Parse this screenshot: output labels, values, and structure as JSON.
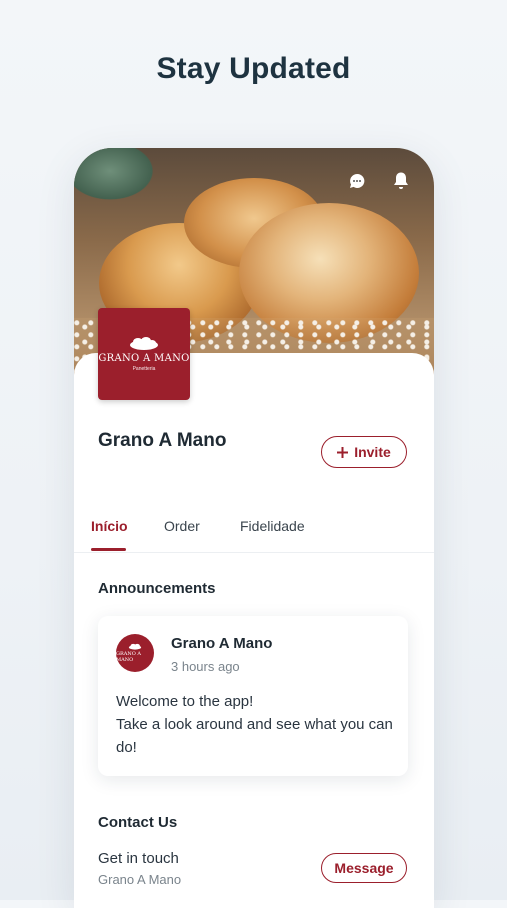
{
  "headline": "Stay Updated",
  "colors": {
    "brand": "#9b1f2c",
    "text": "#1f2a33",
    "muted": "#7a848c"
  },
  "header_icons": [
    "chat-icon",
    "bell-icon"
  ],
  "business": {
    "name": "Grano A Mano",
    "logo_text": "GRANO A MANO",
    "logo_subtext": "Panetteria"
  },
  "invite": {
    "label": "Invite",
    "icon": "plus-icon"
  },
  "tabs": [
    {
      "label": "Início",
      "active": true
    },
    {
      "label": "Order",
      "active": false
    },
    {
      "label": "Fidelidade",
      "active": false
    }
  ],
  "announcements": {
    "title": "Announcements",
    "post": {
      "author": "Grano A Mano",
      "time": "3 hours ago",
      "line1": "Welcome to the app!",
      "line2": "Take a look around and see what you can do!"
    }
  },
  "contact": {
    "title": "Contact Us",
    "prompt": "Get in touch",
    "name": "Grano A Mano",
    "button": "Message"
  }
}
